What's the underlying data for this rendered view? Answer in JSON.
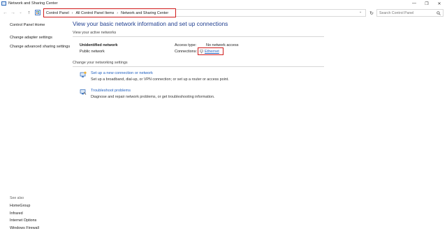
{
  "window": {
    "title": "Network and Sharing Center"
  },
  "window_controls": {
    "minimize": "—",
    "restore": "❐",
    "close": "✕"
  },
  "nav": {
    "back": "←",
    "forward": "→",
    "recent": "⌄",
    "up": "↑"
  },
  "breadcrumb": [
    "Control Panel",
    "All Control Panel Items",
    "Network and Sharing Center"
  ],
  "breadcrumb_separator": "›",
  "address_bar": {
    "dropdown": "⌄",
    "refresh": "↻"
  },
  "search": {
    "placeholder": "Search Control Panel",
    "icon": "search-icon"
  },
  "left_pane": {
    "items": [
      "Control Panel Home",
      "Change adapter settings",
      "Change advanced sharing settings"
    ]
  },
  "see_also": {
    "title": "See also",
    "items": [
      "HomeGroup",
      "Infrared",
      "Internet Options",
      "Windows Firewall"
    ]
  },
  "main": {
    "title": "View your basic network information and set up connections",
    "active_networks_label": "View your active networks",
    "network": {
      "name": "Unidentified network",
      "type": "Public network",
      "access_type_label": "Access type:",
      "access_type_value": "No network access",
      "connections_label": "Connections:",
      "connection_name": "Ethernet"
    },
    "change_settings_label": "Change your networking settings",
    "tasks": [
      {
        "link": "Set up a new connection or network",
        "desc": "Set up a broadband, dial-up, or VPN connection; or set up a router or access point."
      },
      {
        "link": "Troubleshoot problems",
        "desc": "Diagnose and repair network problems, or get troubleshooting information."
      }
    ]
  },
  "colors": {
    "link": "#1f5fbf",
    "title": "#1e3d8f",
    "highlight_box": "#d01c1c"
  }
}
